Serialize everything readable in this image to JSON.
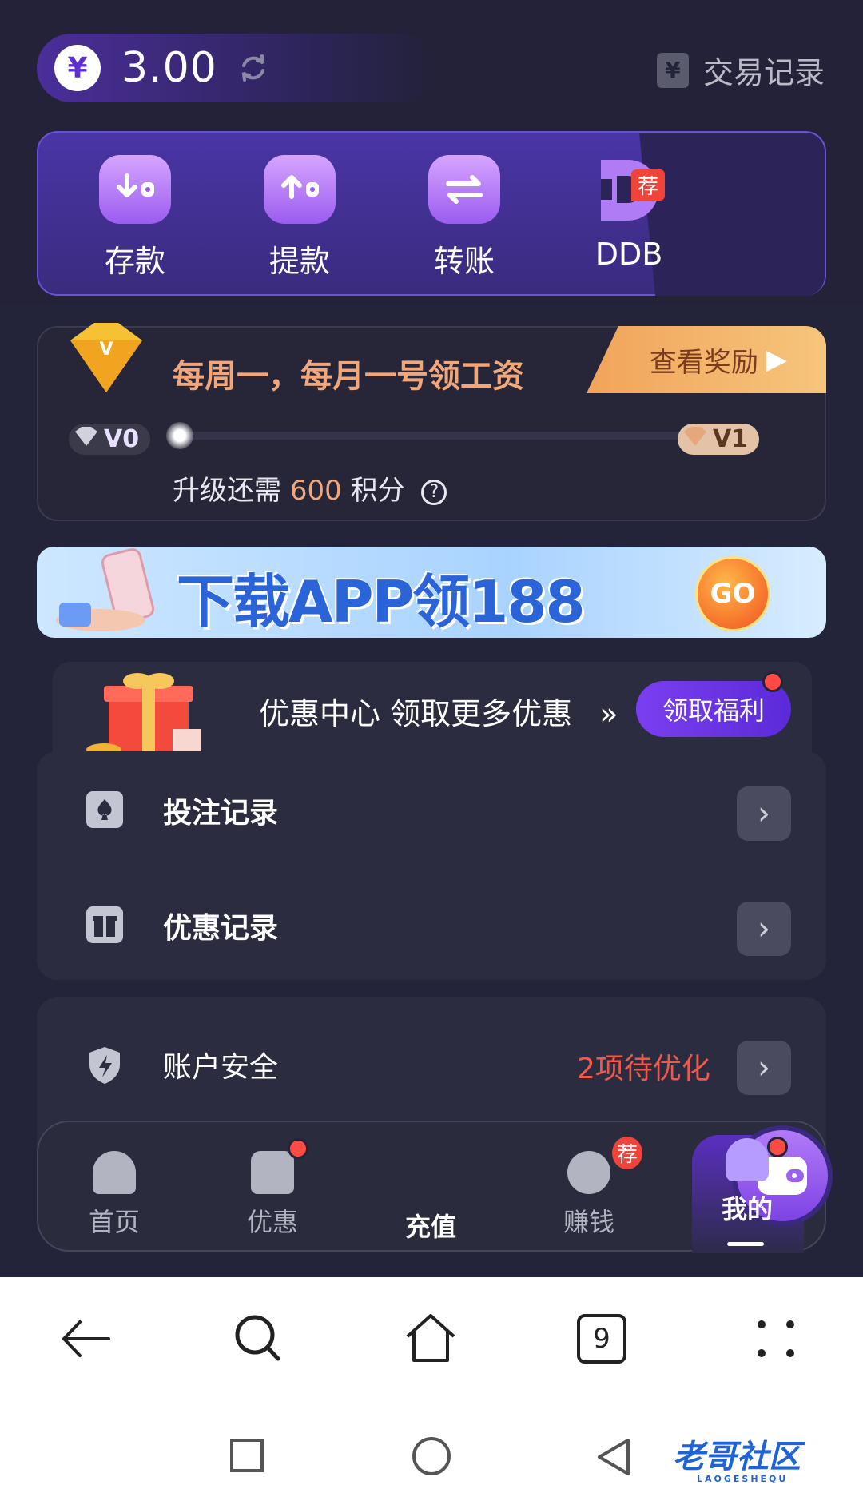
{
  "balance": {
    "currency_symbol": "¥",
    "amount": "3.00"
  },
  "header": {
    "transactions_label": "交易记录",
    "transactions_icon_glyph": "¥"
  },
  "actions": [
    {
      "label": "存款",
      "icon": "deposit-icon"
    },
    {
      "label": "提款",
      "icon": "withdraw-icon"
    },
    {
      "label": "转账",
      "icon": "transfer-icon"
    },
    {
      "label": "DDB",
      "icon": "ddb-logo-icon",
      "badge": "荐"
    }
  ],
  "vip": {
    "title": "每周一，每月一号领工资",
    "reward_button": "查看奖励",
    "current_level": "V0",
    "next_level": "V1",
    "progress": 0,
    "need_prefix": "升级还需",
    "need_points": "600",
    "need_suffix": "积分",
    "help_glyph": "?"
  },
  "banner": {
    "text": "下载APP领188",
    "go_label": "GO"
  },
  "promo": {
    "text": "优惠中心 领取更多优惠",
    "chevrons": "»",
    "button": "领取福利"
  },
  "list": [
    {
      "label": "投注记录",
      "icon": "bet-record-icon"
    },
    {
      "label": "优惠记录",
      "icon": "gift-record-icon"
    }
  ],
  "security": {
    "label": "账户安全",
    "status": "2项待优化",
    "icon": "shield-icon"
  },
  "tabbar": {
    "items": [
      {
        "label": "首页",
        "icon": "home-icon"
      },
      {
        "label": "优惠",
        "icon": "gift-icon",
        "dot": true
      },
      {
        "label": "充值",
        "icon": "wallet-icon"
      },
      {
        "label": "赚钱",
        "icon": "earn-icon",
        "badge": "荐"
      },
      {
        "label": "我的",
        "icon": "user-icon",
        "dot": true,
        "active": true
      }
    ]
  },
  "browser": {
    "tab_count": "9"
  },
  "watermark": {
    "text": "老哥社区",
    "sub": "LAOGESHEQU"
  },
  "colors": {
    "accent": "#5b2ad8",
    "warning": "#f0584a",
    "vip_orange": "#f0a77b",
    "badge_red": "#ff4b43"
  }
}
